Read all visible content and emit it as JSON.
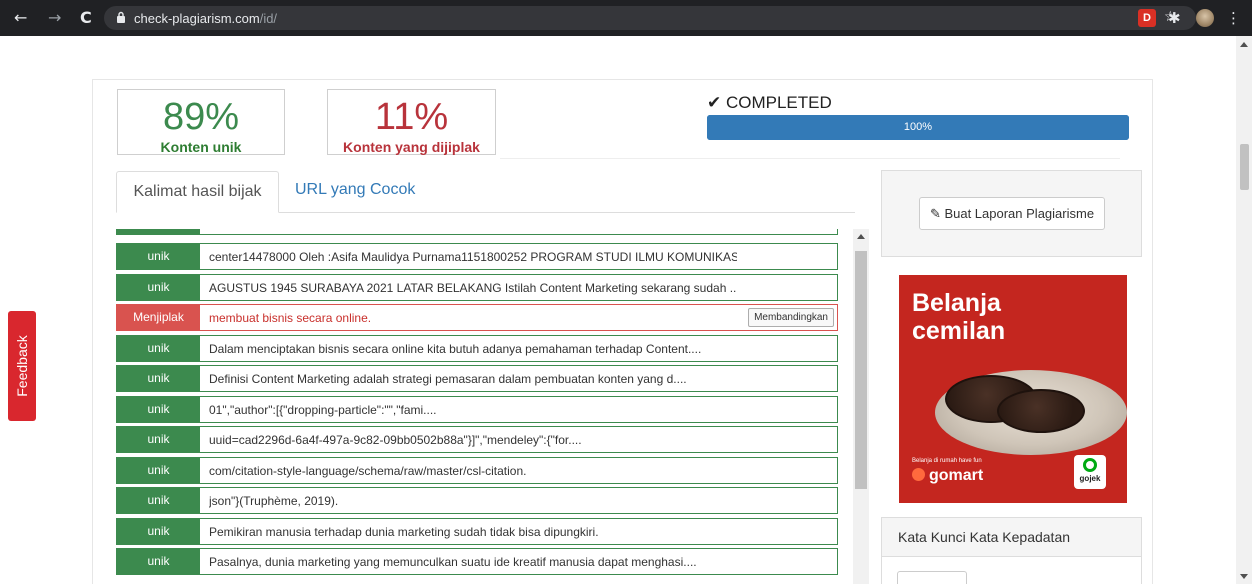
{
  "browser": {
    "url_domain": "check-plagiarism.com",
    "url_path": "/id/",
    "nav_back": "←",
    "nav_forward": "→",
    "nav_reload": "C",
    "star": "☆",
    "ext_label": "D",
    "puzzle": "✱",
    "menu": "⋮"
  },
  "feedback": {
    "label": "Feedback"
  },
  "stats": {
    "unique_percent": "89%",
    "unique_label": "Konten unik",
    "plag_percent": "11%",
    "plag_label": "Konten yang dijiplak"
  },
  "status": {
    "completed": "✔ COMPLETED",
    "progress_value": 1.0,
    "progress_label": "100%"
  },
  "tabs": [
    {
      "label": "Kalimat hasil bijak",
      "active": true
    },
    {
      "label": "URL yang Cocok",
      "active": false
    }
  ],
  "results": [
    {
      "tag": "unik",
      "type": "unique",
      "text": "center14478000 Oleh :Asifa Maulidya Purnama1151800252 PROGRAM STUDI ILMU KOMUNIKAS...."
    },
    {
      "tag": "unik",
      "type": "unique",
      "text": "AGUSTUS 1945 SURABAYA 2021 LATAR BELAKANG Istilah Content Marketing sekarang sudah ...."
    },
    {
      "tag": "Menjiplak",
      "type": "plag",
      "text": "membuat bisnis secara online.",
      "button": "Membandingkan"
    },
    {
      "tag": "unik",
      "type": "unique",
      "text": "Dalam menciptakan bisnis secara online kita butuh adanya pemahaman terhadap Content...."
    },
    {
      "tag": "unik",
      "type": "unique",
      "text": "Definisi Content Marketing adalah strategi pemasaran dalam pembuatan konten yang d...."
    },
    {
      "tag": "unik",
      "type": "unique",
      "text": "01\",\"author\":[{\"dropping-particle\":\"\",\"fami...."
    },
    {
      "tag": "unik",
      "type": "unique",
      "text": "uuid=cad2296d-6a4f-497a-9c82-09bb0502b88a\"}]\",\"mendeley\":{\"for...."
    },
    {
      "tag": "unik",
      "type": "unique",
      "text": "com/citation-style-language/schema/raw/master/csl-citation."
    },
    {
      "tag": "unik",
      "type": "unique",
      "text": "json\"}(Truphème, 2019)."
    },
    {
      "tag": "unik",
      "type": "unique",
      "text": "Pemikiran manusia terhadap dunia marketing sudah tidak bisa dipungkiri."
    },
    {
      "tag": "unik",
      "type": "unique",
      "text": "Pasalnya, dunia marketing yang memunculkan suatu ide kreatif manusia dapat menghasi...."
    }
  ],
  "report": {
    "button_label": "✎ Buat Laporan Plagiarisme"
  },
  "ad": {
    "title_line1": "Belanja",
    "title_line2": "cemilan",
    "tagline": "Belanja di rumah have fun",
    "brand": "gomart",
    "partner": "gojek"
  },
  "keywords": {
    "title": "Kata Kunci Kata Kepadatan"
  },
  "colors": {
    "unique": "#3c8a4e",
    "plag": "#d9534f",
    "progress": "#337ab7",
    "feedback": "#d9272e"
  }
}
